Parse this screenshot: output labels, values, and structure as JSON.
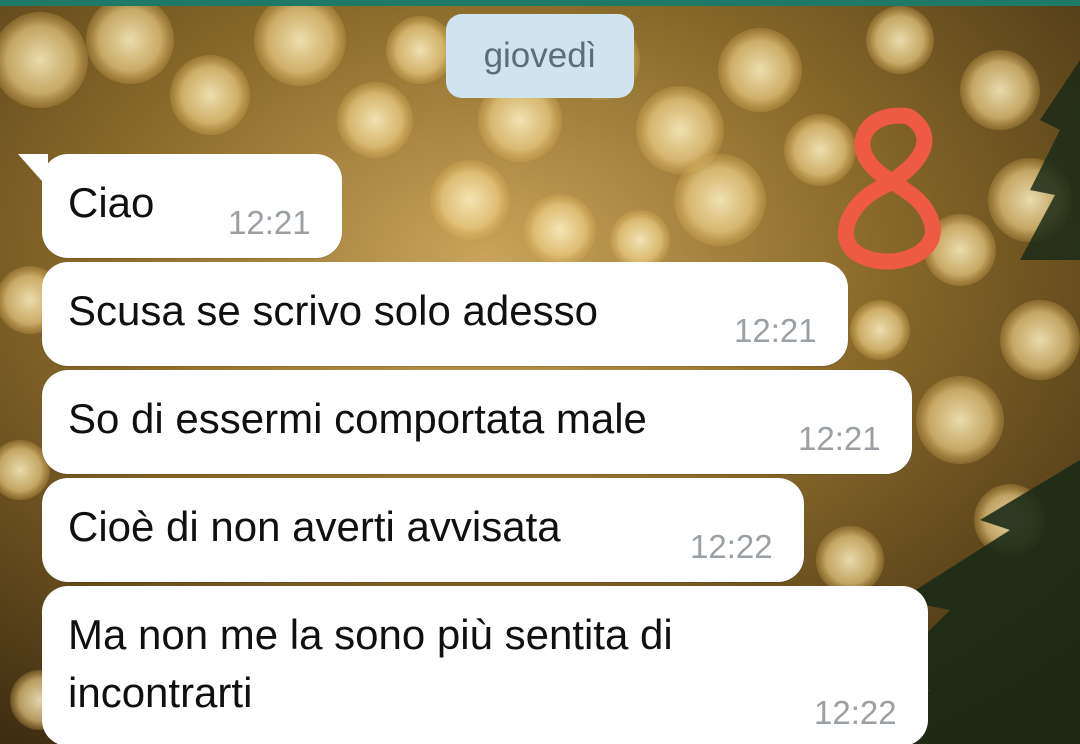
{
  "date_separator": "giovedì",
  "messages": [
    {
      "text": "Ciao",
      "time": "12:21"
    },
    {
      "text": "Scusa se scrivo solo adesso",
      "time": "12:21"
    },
    {
      "text": "So di essermi comportata male",
      "time": "12:21"
    },
    {
      "text": "Cioè di non averti avvisata",
      "time": "12:22"
    },
    {
      "line1": "Ma non me la sono più sentita di",
      "line2": "incontrarti",
      "time": "12:22"
    }
  ],
  "annotation": {
    "text": "8",
    "color": "#ee5a43"
  },
  "colors": {
    "header_bar": "#1e7a66",
    "bubble": "#ffffff",
    "date_chip": "#cfe4ef",
    "timestamp": "#9aa0a4"
  }
}
